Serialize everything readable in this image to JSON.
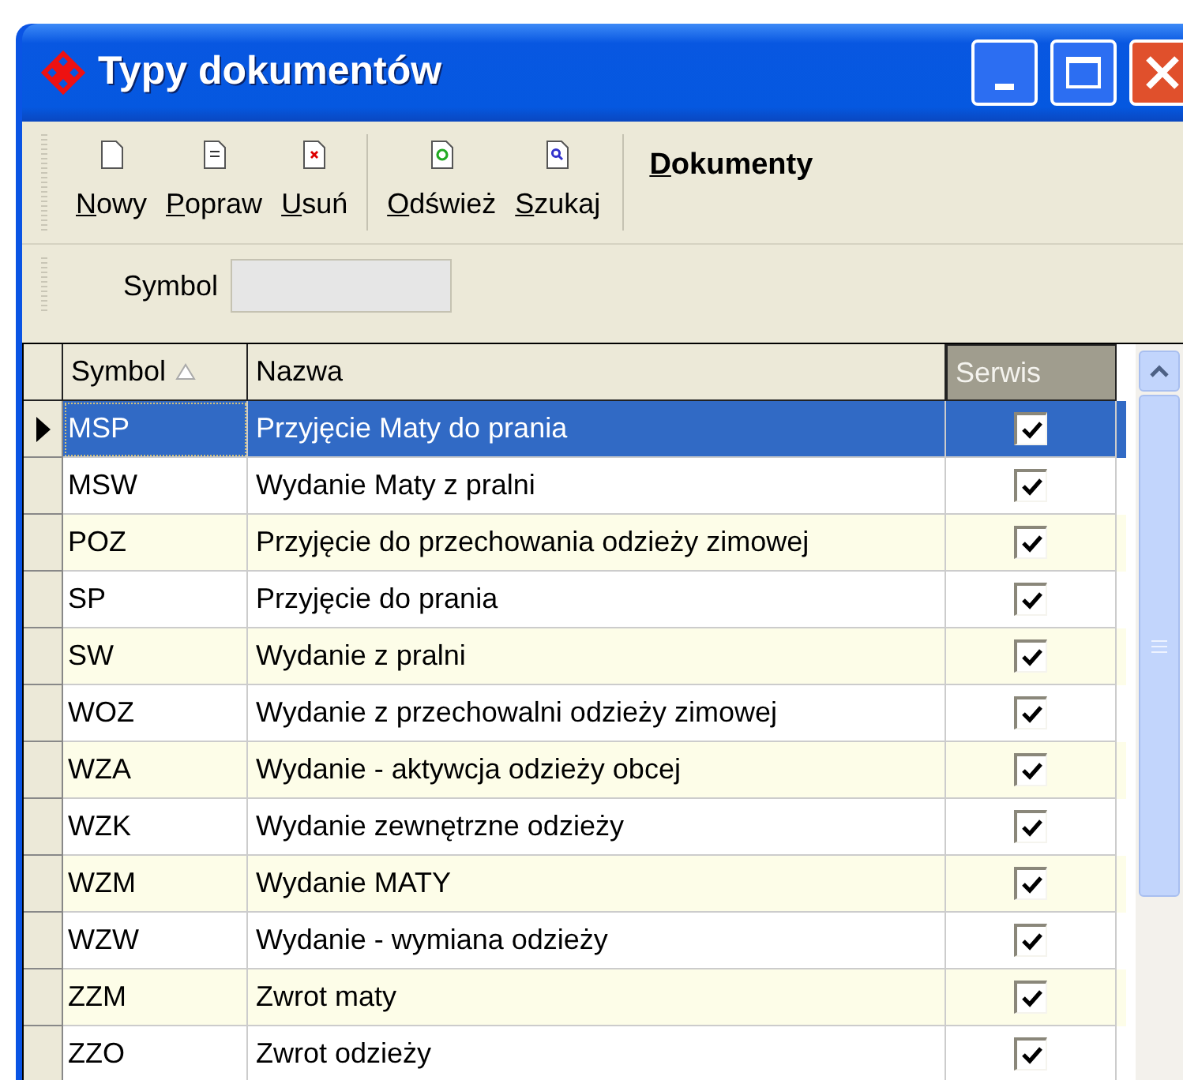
{
  "window": {
    "title": "Typy dokumentów"
  },
  "toolbar": {
    "buttons": [
      {
        "label": "Nowy",
        "kind": "new"
      },
      {
        "label": "Popraw",
        "kind": "edit"
      },
      {
        "label": "Usuń",
        "kind": "delete"
      },
      {
        "label": "Odśwież",
        "kind": "refresh"
      },
      {
        "label": "Szukaj",
        "kind": "search"
      }
    ],
    "section": "Dokumenty"
  },
  "filter": {
    "label": "Symbol"
  },
  "table": {
    "columns": [
      "Symbol",
      "Nazwa",
      "Serwis"
    ],
    "rows": [
      {
        "symbol": "MSP",
        "name": "Przyjęcie Maty do prania",
        "service": true,
        "selected": true
      },
      {
        "symbol": "MSW",
        "name": "Wydanie Maty z pralni",
        "service": true,
        "selected": false
      },
      {
        "symbol": "POZ",
        "name": "Przyjęcie do przechowania odzieży zimowej",
        "service": true,
        "selected": false
      },
      {
        "symbol": "SP",
        "name": "Przyjęcie do prania",
        "service": true,
        "selected": false
      },
      {
        "symbol": "SW",
        "name": "Wydanie z pralni",
        "service": true,
        "selected": false
      },
      {
        "symbol": "WOZ",
        "name": "Wydanie z przechowalni odzieży zimowej",
        "service": true,
        "selected": false
      },
      {
        "symbol": "WZA",
        "name": "Wydanie - aktywcja odzieży obcej",
        "service": true,
        "selected": false
      },
      {
        "symbol": "WZK",
        "name": "Wydanie zewnętrzne odzieży",
        "service": true,
        "selected": false
      },
      {
        "symbol": "WZM",
        "name": "Wydanie MATY",
        "service": true,
        "selected": false
      },
      {
        "symbol": "WZW",
        "name": "Wydanie - wymiana odzieży",
        "service": true,
        "selected": false
      },
      {
        "symbol": "ZZM",
        "name": "Zwrot maty",
        "service": true,
        "selected": false
      },
      {
        "symbol": "ZZO",
        "name": "Zwrot odzieży",
        "service": true,
        "selected": false
      }
    ]
  }
}
